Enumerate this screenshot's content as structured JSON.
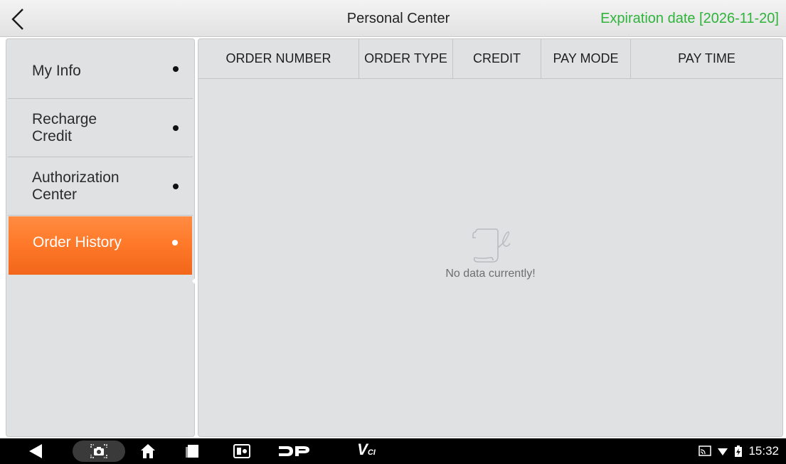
{
  "header": {
    "title": "Personal Center",
    "expiration": "Expiration date [2026-11-20]",
    "expiration_color": "#2fb33a"
  },
  "sidebar": {
    "items": [
      {
        "label": "My Info",
        "active": false
      },
      {
        "label": "Recharge Credit",
        "active": false
      },
      {
        "label": "Authorization Center",
        "active": false
      },
      {
        "label": "Order History",
        "active": true
      }
    ],
    "active_color": "#ff7a2a"
  },
  "table": {
    "columns": [
      "ORDER NUMBER",
      "ORDER TYPE",
      "CREDIT",
      "PAY MODE",
      "PAY TIME"
    ],
    "rows": []
  },
  "empty_state": {
    "icon": "empty-scroll-icon",
    "message": "No data currently!"
  },
  "nav_bar": {
    "icons": [
      "back-triangle-icon",
      "screenshot-camera-icon",
      "home-icon",
      "recent-apps-icon",
      "app-switch-icon",
      "dp-app-icon",
      "vci-app-icon"
    ],
    "vci_label": "V",
    "vci_sub": "CI",
    "status_icons": [
      "cast-icon",
      "wifi-icon",
      "battery-icon"
    ],
    "time": "15:32"
  }
}
